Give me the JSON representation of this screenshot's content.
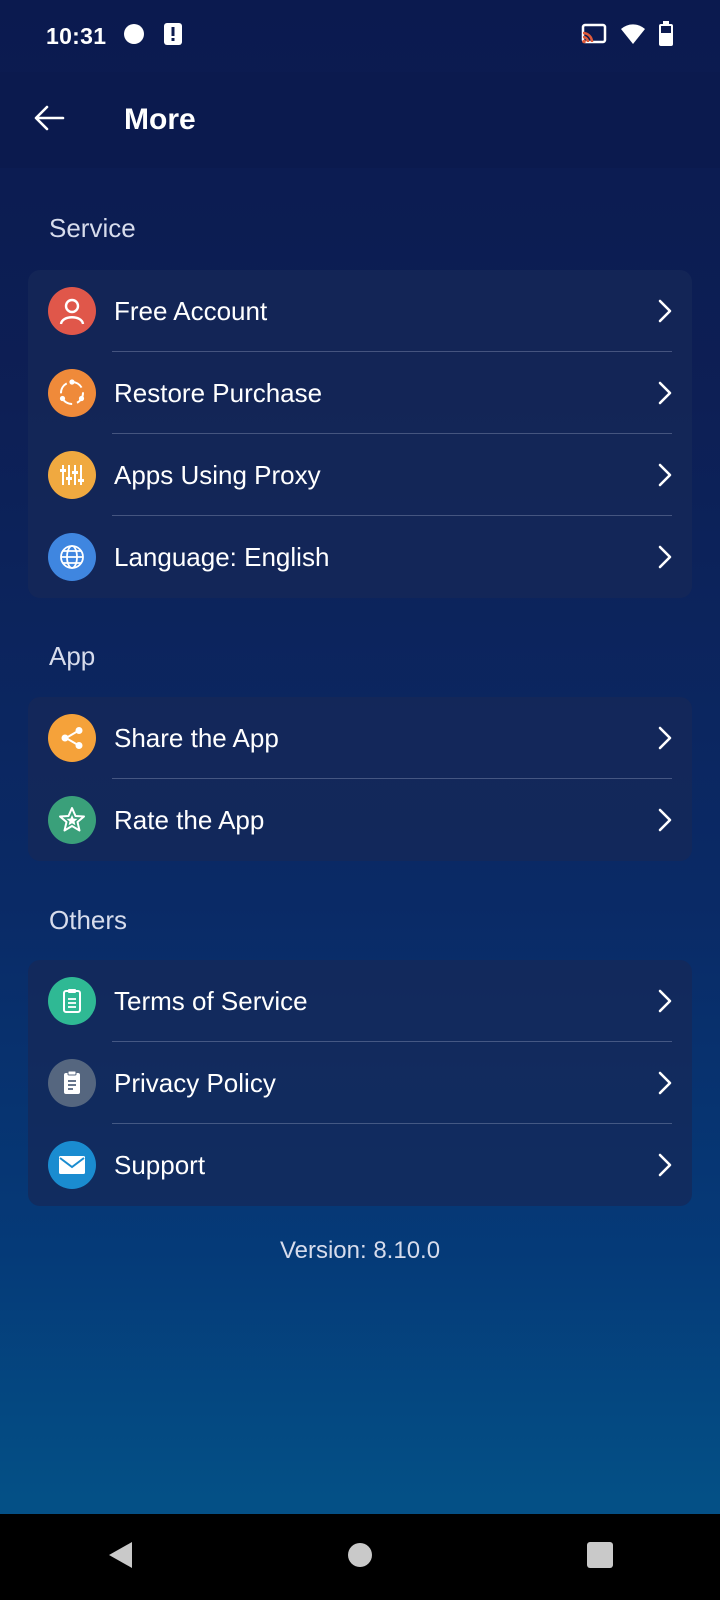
{
  "status_bar": {
    "time": "10:31",
    "icons": [
      "circle-notification-icon",
      "alert-notification-icon",
      "cast-icon",
      "wifi-icon",
      "battery-icon"
    ]
  },
  "header": {
    "title": "More",
    "back_icon": "arrow-left-icon"
  },
  "sections": [
    {
      "title": "Service",
      "items": [
        {
          "label": "Free Account",
          "icon": "user-icon",
          "color": "#e0574a"
        },
        {
          "label": "Restore Purchase",
          "icon": "restore-icon",
          "color": "#ef8a3a"
        },
        {
          "label": "Apps Using Proxy",
          "icon": "sliders-icon",
          "color": "#f0a940"
        },
        {
          "label": "Language: English",
          "icon": "globe-icon",
          "color": "#3f86e0"
        }
      ]
    },
    {
      "title": "App",
      "items": [
        {
          "label": "Share the App",
          "icon": "share-icon",
          "color": "#f5a23a"
        },
        {
          "label": "Rate the App",
          "icon": "star-icon",
          "color": "#3aa07a"
        }
      ]
    },
    {
      "title": "Others",
      "items": [
        {
          "label": "Terms of Service",
          "icon": "clipboard-icon",
          "color": "#2fb994"
        },
        {
          "label": "Privacy Policy",
          "icon": "document-icon",
          "color": "#55667f"
        },
        {
          "label": "Support",
          "icon": "mail-icon",
          "color": "#1a8cd0"
        }
      ]
    }
  ],
  "footer": {
    "version": "Version: 8.10.0"
  },
  "nav_bar": {
    "icons": [
      "back-triangle-icon",
      "home-circle-icon",
      "recents-square-icon"
    ]
  }
}
